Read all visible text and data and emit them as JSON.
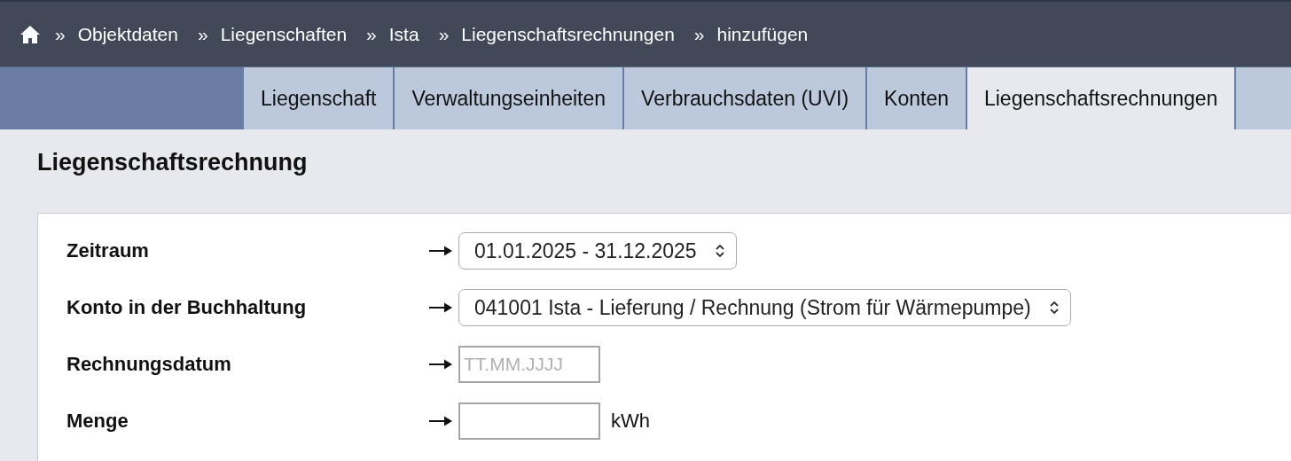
{
  "breadcrumb": {
    "separator": "»",
    "items": [
      {
        "label": "Objektdaten"
      },
      {
        "label": "Liegenschaften"
      },
      {
        "label": "Ista"
      },
      {
        "label": "Liegenschaftsrechnungen"
      },
      {
        "label": "hinzufügen"
      }
    ]
  },
  "tabs": [
    {
      "label": "Liegenschaft",
      "selected": false
    },
    {
      "label": "Verwaltungseinheiten",
      "selected": false
    },
    {
      "label": "Verbrauchsdaten (UVI)",
      "selected": false
    },
    {
      "label": "Konten",
      "selected": false
    },
    {
      "label": "Liegenschaftsrechnungen",
      "selected": true
    }
  ],
  "heading": "Liegenschaftsrechnung",
  "form": [
    {
      "kind": "select",
      "label": "Zeitraum",
      "value": "01.01.2025 - 31.12.2025"
    },
    {
      "kind": "select",
      "label": "Konto in der Buchhaltung",
      "value": "041001 Ista - Lieferung / Rechnung (Strom für Wärmepumpe)"
    },
    {
      "kind": "input",
      "label": "Rechnungsdatum",
      "placeholder": "TT.MM.JJJJ"
    },
    {
      "kind": "input",
      "label": "Menge",
      "unit": "kWh"
    }
  ]
}
